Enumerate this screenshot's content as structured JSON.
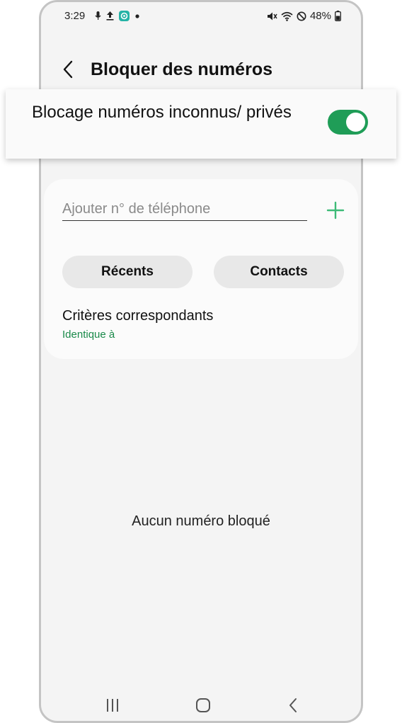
{
  "status_bar": {
    "time": "3:29",
    "battery": "48%",
    "icons": [
      "microphone-icon",
      "upload-icon",
      "app-notification-icon",
      "dot-icon",
      "mute-icon",
      "wifi-icon",
      "do-not-disturb-icon",
      "battery-icon"
    ]
  },
  "header": {
    "back_icon": "chevron-left-icon",
    "title": "Bloquer des numéros"
  },
  "unknown_block": {
    "label": "Blocage numéros inconnus/ privés",
    "toggle_on": true
  },
  "add_number": {
    "placeholder": "Ajouter n° de téléphone",
    "value": "",
    "add_icon": "plus-icon"
  },
  "buttons": {
    "recents": "Récents",
    "contacts": "Contacts"
  },
  "criteria": {
    "title": "Critères correspondants",
    "value": "Identique à"
  },
  "empty_state": "Aucun numéro bloqué",
  "nav_bar": {
    "icons": [
      "recents-nav-icon",
      "home-nav-icon",
      "back-nav-icon"
    ]
  },
  "colors": {
    "accent_green": "#1f9d57",
    "plus_green": "#3dbb77",
    "criteria_green": "#1a8a4a",
    "background": "#f4f4f4",
    "card": "#fbfbfb"
  }
}
